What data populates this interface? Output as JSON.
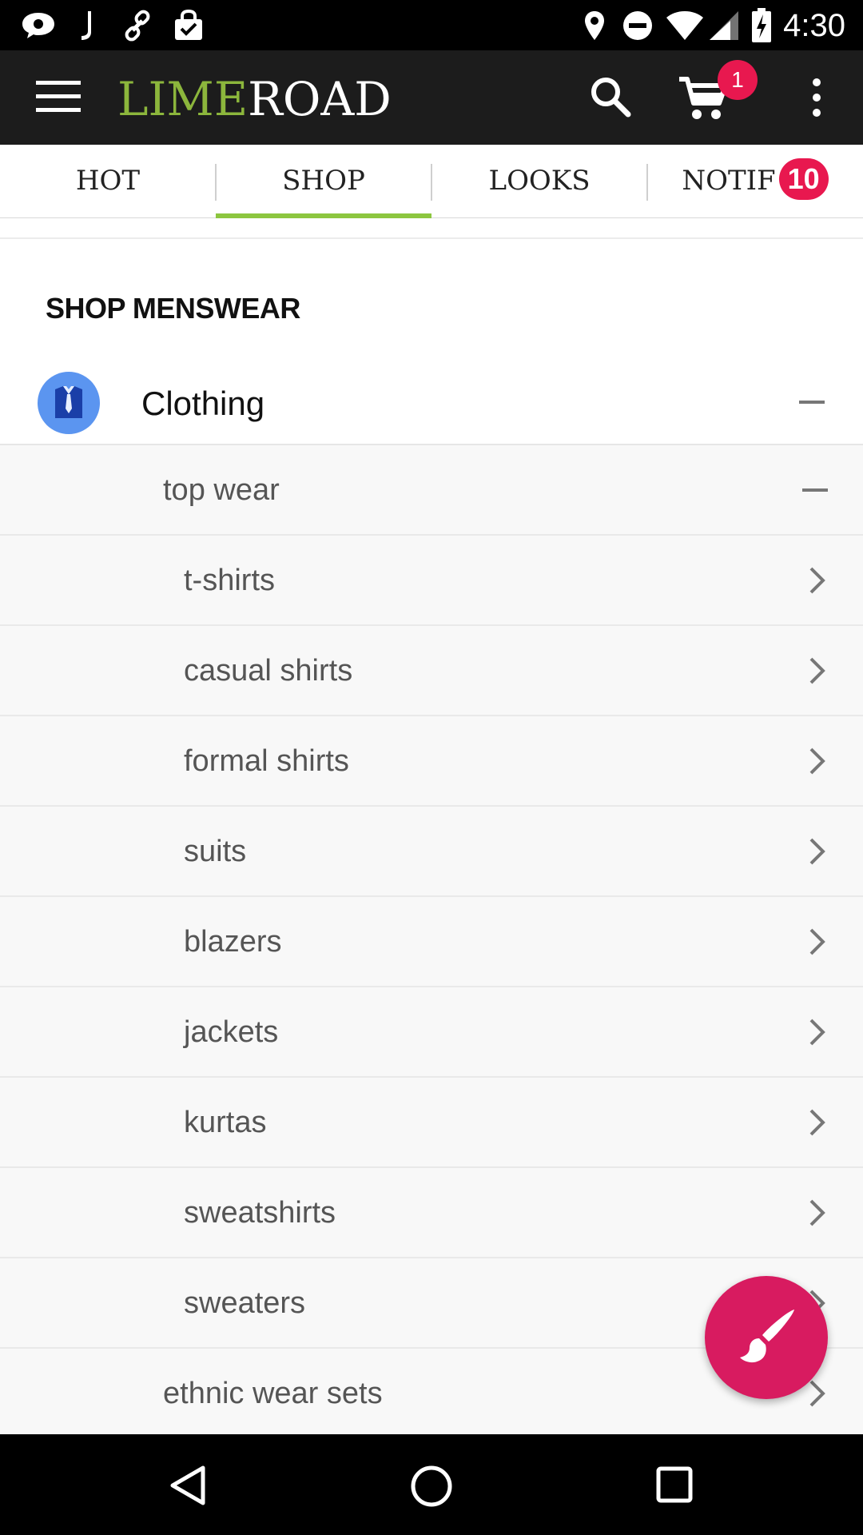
{
  "status_bar": {
    "time": "4:30",
    "left_icons": [
      "chat-icon",
      "j-app-icon",
      "link-app-icon",
      "shopping-bag-icon"
    ],
    "right_icons": [
      "location-icon",
      "do-not-disturb-icon",
      "wifi-icon",
      "signal-icon",
      "battery-charging-icon"
    ]
  },
  "app_bar": {
    "logo_part1": "LIME",
    "logo_part2": "ROAD",
    "cart_count": "1",
    "icons": [
      "menu-icon",
      "search-icon",
      "cart-icon",
      "more-vert-icon"
    ],
    "colors": {
      "background": "#1c1c1c",
      "brand_green": "#8cb63c",
      "badge": "#e8184f"
    }
  },
  "tabs": [
    {
      "label": "HOT"
    },
    {
      "label": "SHOP",
      "selected": true
    },
    {
      "label": "LOOKS"
    },
    {
      "label": "NOTIF",
      "badge": "10"
    }
  ],
  "main": {
    "section_title": "SHOP MENSWEAR",
    "category": {
      "label": "Clothing",
      "icon": "shirt-icon",
      "expanded": true
    },
    "subcategory": {
      "label": "top wear",
      "expanded": true
    },
    "items": [
      {
        "label": "t-shirts"
      },
      {
        "label": "casual shirts"
      },
      {
        "label": "formal shirts"
      },
      {
        "label": "suits"
      },
      {
        "label": "blazers"
      },
      {
        "label": "jackets"
      },
      {
        "label": "kurtas"
      },
      {
        "label": "sweatshirts"
      },
      {
        "label": "sweaters"
      }
    ],
    "next_subcategory": {
      "label": "ethnic wear sets"
    }
  },
  "fab": {
    "icon": "brush-icon",
    "color": "#d81b60"
  },
  "nav_bar": {
    "icons": [
      "back-icon",
      "home-icon",
      "recents-icon"
    ]
  }
}
